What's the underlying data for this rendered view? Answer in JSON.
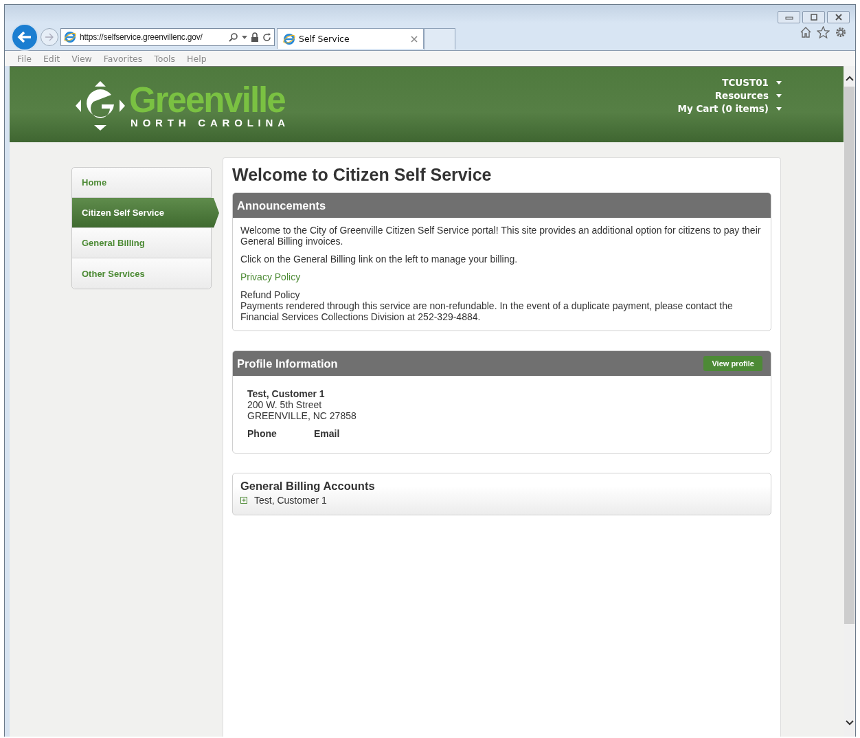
{
  "browser": {
    "address": "https://selfservice.greenvillenc.gov/",
    "tab_title": "Self Service",
    "menu": [
      "File",
      "Edit",
      "View",
      "Favorites",
      "Tools",
      "Help"
    ]
  },
  "header": {
    "logo_name": "Greenville",
    "logo_subtitle": "NORTH CAROLINA",
    "user_menu": [
      "TCUST01",
      "Resources",
      "My Cart (0 items)"
    ]
  },
  "nav": [
    {
      "label": "Home",
      "selected": false
    },
    {
      "label": "Citizen Self Service",
      "selected": true
    },
    {
      "label": "General Billing",
      "selected": false
    },
    {
      "label": "Other Services",
      "selected": false
    }
  ],
  "page_title": "Welcome to Citizen Self Service",
  "announcements": {
    "title": "Announcements",
    "paragraphs": [
      "Welcome to the City of Greenville Citizen Self Service portal! This site provides an additional option for citizens to pay their General Billing invoices.",
      "Click on the General Billing link on the left to manage your billing."
    ],
    "link": "Privacy Policy",
    "refund_title": "Refund Policy",
    "refund_text": "Payments rendered through this service are non-refundable. In the event of a duplicate payment, please contact the Financial Services Collections Division at 252-329-4884."
  },
  "profile": {
    "title": "Profile Information",
    "button": "View profile",
    "name": "Test, Customer 1",
    "address_lines": [
      "200 W. 5th Street",
      "GREENVILLE, NC 27858"
    ],
    "phone_label": "Phone",
    "email_label": "Email"
  },
  "accounts": {
    "title": "General Billing Accounts",
    "items": [
      {
        "label": "Test, Customer 1",
        "expanded": false
      }
    ]
  }
}
